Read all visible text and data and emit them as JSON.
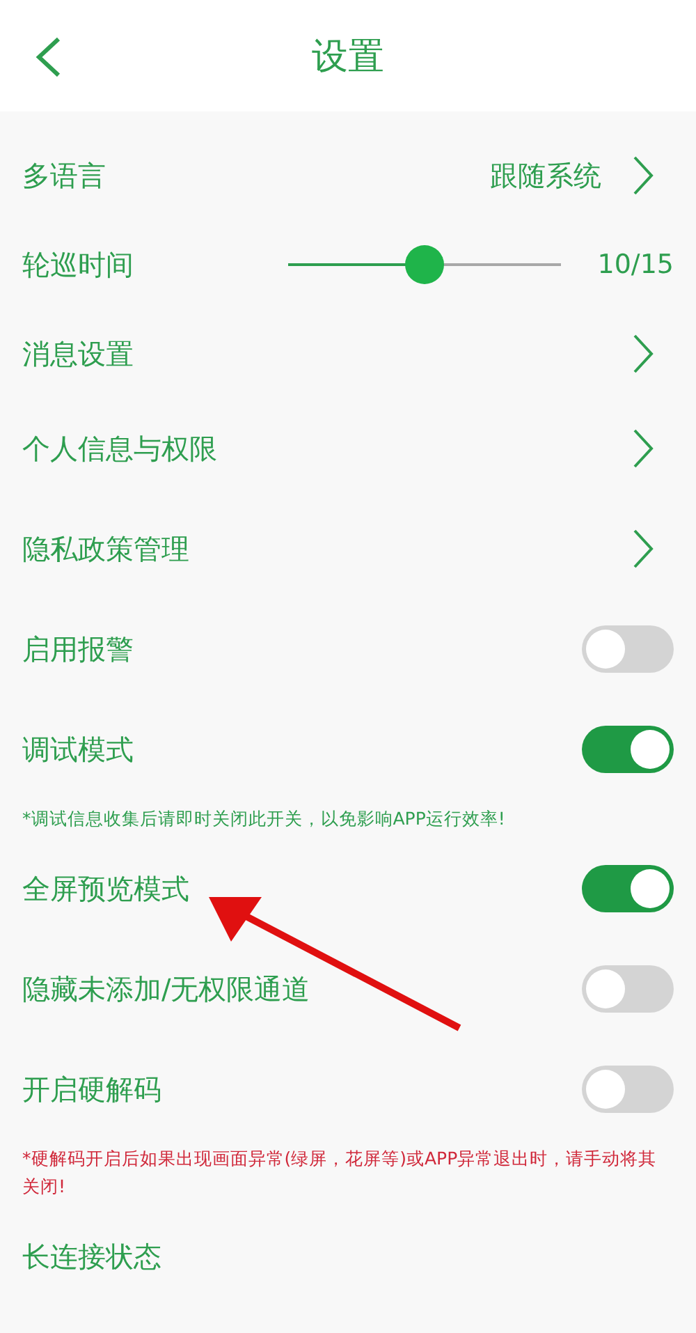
{
  "header": {
    "title": "设置"
  },
  "items": [
    {
      "kind": "link",
      "label": "多语言",
      "value": "跟随系统"
    },
    {
      "kind": "slider",
      "label": "轮巡时间",
      "level": 0.5,
      "reading": "10/15"
    },
    {
      "kind": "link",
      "label": "消息设置"
    },
    {
      "kind": "link",
      "label": "个人信息与权限"
    },
    {
      "kind": "link",
      "label": "隐私政策管理"
    },
    {
      "kind": "toggle",
      "label": "启用报警",
      "on": false
    },
    {
      "kind": "toggle",
      "label": "调试模式",
      "on": true
    },
    {
      "kind": "note",
      "text": "*调试信息收集后请即时关闭此开关，以免影响APP运行效率!",
      "color": "#2e9e4f"
    },
    {
      "kind": "toggle",
      "label": "全屏预览模式",
      "on": true
    },
    {
      "kind": "toggle",
      "label": "隐藏未添加/无权限通道",
      "on": false
    },
    {
      "kind": "toggle",
      "label": "开启硬解码",
      "on": false
    },
    {
      "kind": "note",
      "text": "*硬解码开启后如果出现画面异常(绿屏，花屏等)或APP异常退出时，请手动将其关闭!",
      "color": "#d0283a"
    },
    {
      "kind": "plain",
      "label": "长连接状态"
    }
  ],
  "annotation": {
    "kind": "arrow"
  }
}
